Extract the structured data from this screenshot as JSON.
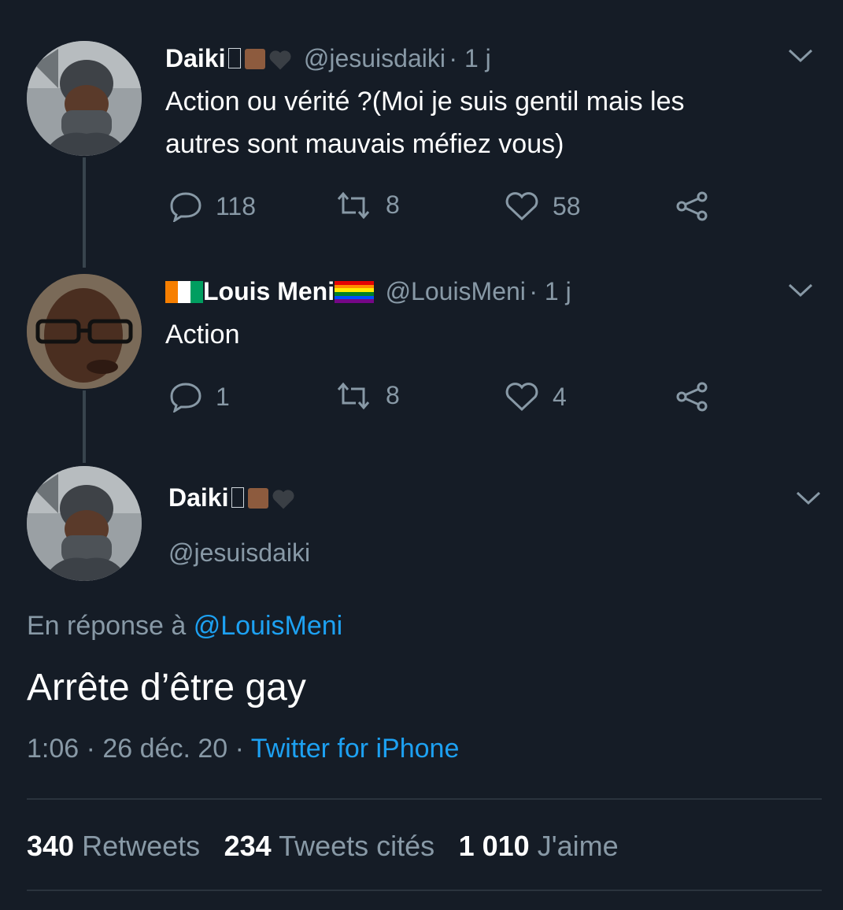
{
  "tweets": [
    {
      "name": "Daiki",
      "handle": "@jesuisdaiki",
      "time": "· 1 j",
      "text_line1": "Action ou vérité ?(Moi je suis gentil mais les",
      "text_line2": "autres sont mauvais méfiez vous)",
      "replies": "118",
      "retweets": "8",
      "likes": "58"
    },
    {
      "name": "Louis Meni",
      "handle": "@LouisMeni",
      "time": "· 1 j",
      "text": "Action",
      "replies": "1",
      "retweets": "8",
      "likes": "4"
    }
  ],
  "main_tweet": {
    "name": "Daiki",
    "handle": "@jesuisdaiki",
    "reply_prefix": "En réponse à",
    "reply_to": "@LouisMeni",
    "text": "Arrête d’être gay",
    "timestamp": "1:06 · 26 déc. 20 ·",
    "source": "Twitter for iPhone"
  },
  "stats": [
    {
      "value": "340",
      "label": "Retweets"
    },
    {
      "value": "234",
      "label": "Tweets cités"
    },
    {
      "value": "1 010",
      "label": "J'aime"
    }
  ],
  "icons": [
    "reply-icon",
    "retweet-icon",
    "like-icon",
    "share-icon",
    "chevron-down-icon"
  ],
  "colors": {
    "background": "#151c26",
    "secondary_text": "#8899a6",
    "link": "#1da1f2"
  }
}
